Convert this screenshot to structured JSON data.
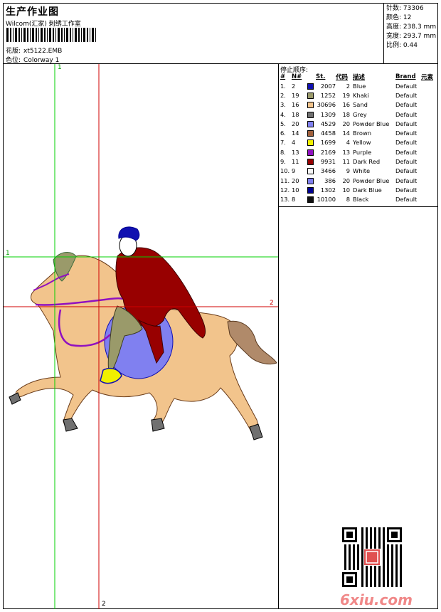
{
  "header": {
    "title": "生产作业图",
    "company": "Wilcom(汇家) 刺绣工作室",
    "file_label": "花版:",
    "file_value": "xt5122.EMB",
    "color_label": "色位:",
    "color_value": "Colorway 1"
  },
  "stats": {
    "stitches_label": "针数:",
    "stitches_value": "73306",
    "colors_label": "颜色:",
    "colors_value": "12",
    "height_label": "高度:",
    "height_value": "238.3 mm",
    "width_label": "宽度:",
    "width_value": "293.7 mm",
    "scale_label": "比例:",
    "scale_value": "0.44"
  },
  "sequence": {
    "title": "停止顺序:",
    "headers": [
      "#",
      "N#",
      "St.",
      "代码",
      "描述",
      "Brand",
      "元素"
    ],
    "rows": [
      {
        "idx": "1.",
        "n": "2",
        "st": "2007",
        "code": "2",
        "desc": "Blue",
        "brand": "Default",
        "color": "#1010b0"
      },
      {
        "idx": "2.",
        "n": "19",
        "st": "1252",
        "code": "19",
        "desc": "Khaki",
        "brand": "Default",
        "color": "#9a9a6a"
      },
      {
        "idx": "3.",
        "n": "16",
        "st": "30696",
        "code": "16",
        "desc": "Sand",
        "brand": "Default",
        "color": "#f2c48c"
      },
      {
        "idx": "4.",
        "n": "18",
        "st": "1309",
        "code": "18",
        "desc": "Grey",
        "brand": "Default",
        "color": "#707070"
      },
      {
        "idx": "5.",
        "n": "20",
        "st": "4529",
        "code": "20",
        "desc": "Powder Blue",
        "brand": "Default",
        "color": "#8080f0"
      },
      {
        "idx": "6.",
        "n": "14",
        "st": "4458",
        "code": "14",
        "desc": "Brown",
        "brand": "Default",
        "color": "#a0603c"
      },
      {
        "idx": "7.",
        "n": "4",
        "st": "1699",
        "code": "4",
        "desc": "Yellow",
        "brand": "Default",
        "color": "#f0f000"
      },
      {
        "idx": "8.",
        "n": "13",
        "st": "2169",
        "code": "13",
        "desc": "Purple",
        "brand": "Default",
        "color": "#9010c0"
      },
      {
        "idx": "9.",
        "n": "11",
        "st": "9931",
        "code": "11",
        "desc": "Dark Red",
        "brand": "Default",
        "color": "#980000"
      },
      {
        "idx": "10.",
        "n": "9",
        "st": "3466",
        "code": "9",
        "desc": "White",
        "brand": "Default",
        "color": "#f6f6f6"
      },
      {
        "idx": "11.",
        "n": "20",
        "st": "386",
        "code": "20",
        "desc": "Powder Blue",
        "brand": "Default",
        "color": "#8080f0"
      },
      {
        "idx": "12.",
        "n": "10",
        "st": "1302",
        "code": "10",
        "desc": "Dark Blue",
        "brand": "Default",
        "color": "#000090"
      },
      {
        "idx": "13.",
        "n": "8",
        "st": "10100",
        "code": "8",
        "desc": "Black",
        "brand": "Default",
        "color": "#101010"
      }
    ]
  },
  "guides": {
    "v1": "1",
    "v2": "2",
    "h1": "1",
    "h2": "2"
  },
  "watermark": "6xiu.com",
  "colors": {
    "guide_green": "#00d000",
    "guide_red": "#d00000"
  }
}
